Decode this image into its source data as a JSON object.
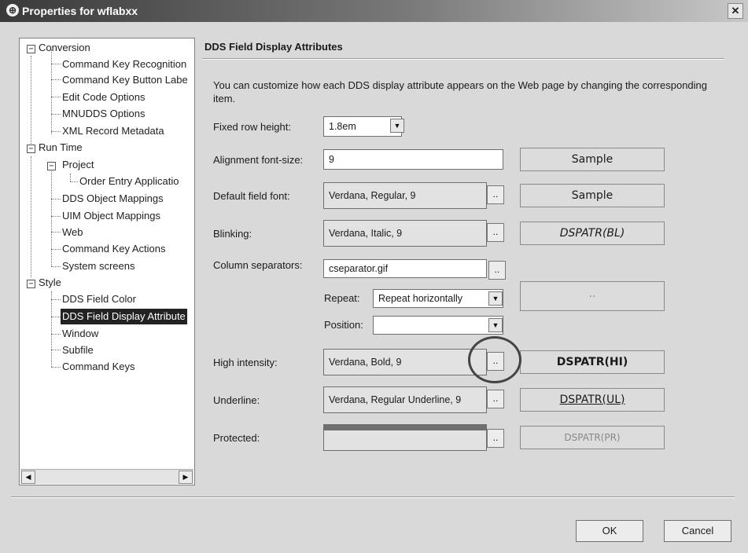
{
  "window": {
    "title": "Properties for wflabxx",
    "close_label": "✕"
  },
  "tree": {
    "toggle_glyph": "−",
    "items": [
      {
        "label": "Conversion"
      },
      {
        "label": "Command Key Recognition"
      },
      {
        "label": "Command Key Button Labe"
      },
      {
        "label": "Edit Code Options"
      },
      {
        "label": "MNUDDS Options"
      },
      {
        "label": "XML Record Metadata"
      },
      {
        "label": "Run Time"
      },
      {
        "label": "Project"
      },
      {
        "label": "Order Entry Applicatio"
      },
      {
        "label": "DDS Object Mappings"
      },
      {
        "label": "UIM Object Mappings"
      },
      {
        "label": "Web"
      },
      {
        "label": "Command Key Actions"
      },
      {
        "label": "System screens"
      },
      {
        "label": "Style"
      },
      {
        "label": "DDS Field Color"
      },
      {
        "label": "DDS Field Display Attribute"
      },
      {
        "label": "Window"
      },
      {
        "label": "Subfile"
      },
      {
        "label": "Command Keys"
      }
    ],
    "scroll_left": "◀",
    "scroll_right": "▶"
  },
  "panel": {
    "title": "DDS Field Display Attributes",
    "description": "You can customize how each DDS display attribute appears on the Web page by changing the corresponding item.",
    "fixed_row_height": {
      "label": "Fixed row height:",
      "value": "1.8em"
    },
    "alignment_font_size": {
      "label": "Alignment font-size:",
      "value": "9",
      "sample": "Sample"
    },
    "default_field_font": {
      "label": "Default field font:",
      "value": "Verdana, Regular, 9",
      "sample": "Sample"
    },
    "blinking": {
      "label": "Blinking:",
      "value": "Verdana, Italic, 9",
      "sample": "DSPATR(BL)"
    },
    "column_separators": {
      "label": "Column separators:",
      "value": "cseparator.gif",
      "repeat_label": "Repeat:",
      "repeat_value": "Repeat horizontally",
      "position_label": "Position:",
      "position_value": "",
      "sample": ".."
    },
    "high_intensity": {
      "label": "High intensity:",
      "value": "Verdana, Bold, 9",
      "sample": "DSPATR(HI)"
    },
    "underline": {
      "label": "Underline:",
      "value": "Verdana, Regular Underline, 9",
      "sample": "DSPATR(UL)"
    },
    "protected": {
      "label": "Protected:",
      "value": "",
      "sample": "DSPATR(PR)"
    },
    "browse_label": "..",
    "dropdown_glyph": "▼"
  },
  "buttons": {
    "ok": "OK",
    "cancel": "Cancel"
  }
}
